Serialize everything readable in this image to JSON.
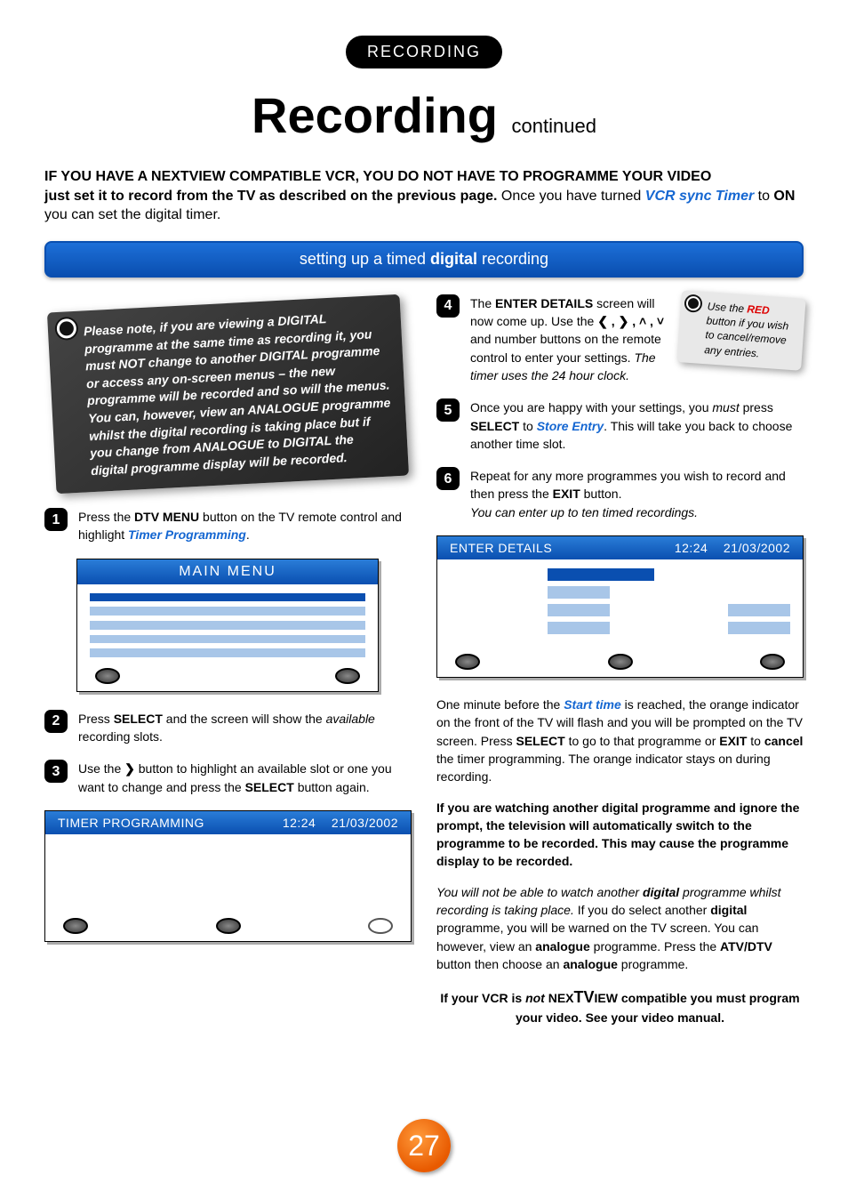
{
  "ribbon": "RECORDING",
  "title_main": "Recording",
  "title_cont": "continued",
  "intro_line1": "IF YOU HAVE A NEXTVIEW COMPATIBLE VCR, YOU DO NOT HAVE TO PROGRAMME YOUR VIDEO",
  "intro_line2_a": "just set it to record from the TV as described on the previous page.",
  "intro_line2_b": " Once you have turned ",
  "intro_line2_c": "VCR sync Timer",
  "intro_line2_d": " to ",
  "intro_line2_e": "ON",
  "intro_line2_f": " you can set the digital timer.",
  "section_header_a": "setting up a timed ",
  "section_header_b": "digital",
  "section_header_c": " recording",
  "note_card": "Please note, if you are viewing a DIGITAL programme at the same time as recording it, you must NOT change to another DIGITAL programme or access any on-screen menus – the new programme will be recorded and so will the menus. You can, however, view an ANALOGUE programme whilst the digital recording is taking place but if you change from ANALOGUE to DIGITAL the digital programme display will be recorded.",
  "tip_a": "Use the ",
  "tip_b": "RED",
  "tip_c": " button if you wish to cancel/remove any entries.",
  "steps": {
    "s1": {
      "num": "1",
      "a": "Press the ",
      "b": "DTV MENU",
      "c": " button on the TV remote control and highlight ",
      "d": "Timer Programming",
      "e": "."
    },
    "s2": {
      "num": "2",
      "a": "Press ",
      "b": "SELECT",
      "c": " and the screen will show the ",
      "d": "available",
      "e": " recording slots."
    },
    "s3": {
      "num": "3",
      "a": "Use the ",
      "arrow": "❯",
      "b": " button to highlight an available slot or one you want to change and press the ",
      "c": "SELECT",
      "d": " button again."
    },
    "s4": {
      "num": "4",
      "a": "The ",
      "b": "ENTER DETAILS",
      "c": " screen will now come up. Use the ",
      "arrows": "❮ , ❯ , ❮ , ❯",
      "d": " and number buttons on the remote control to enter your settings. ",
      "e": "The timer uses the 24 hour clock."
    },
    "s5": {
      "num": "5",
      "a": "Once you are happy with your settings, you ",
      "b": "must",
      "c": " press ",
      "d": "SELECT",
      "e": " to ",
      "f": "Store Entry",
      "g": ". This will take you back to choose another time slot."
    },
    "s6": {
      "num": "6",
      "a": "Repeat for any more programmes you wish to record and then press the ",
      "b": "EXIT",
      "c": " button.",
      "d": "You can enter up to ten timed recordings."
    }
  },
  "screens": {
    "main_menu": "MAIN MENU",
    "timer_prog": {
      "title": "TIMER PROGRAMMING",
      "time": "12:24",
      "date": "21/03/2002"
    },
    "enter_details": {
      "title": "ENTER DETAILS",
      "time": "12:24",
      "date": "21/03/2002"
    }
  },
  "extras": {
    "p1a": "One minute before the ",
    "p1b": "Start time",
    "p1c": " is reached, the orange indicator on the front of the TV will flash and you will be prompted on the TV screen. Press ",
    "p1d": "SELECT",
    "p1e": " to go to that programme or ",
    "p1f": "EXIT",
    "p1g": " to ",
    "p1h": "cancel",
    "p1i": " the timer programming. The orange indicator stays on during recording.",
    "p2": "If you are watching another digital programme and ignore the prompt, the television will automatically switch to the programme to be recorded. This may cause the programme display to be recorded.",
    "p3a": "You will not be able to watch another ",
    "p3b": "digital",
    "p3c": " programme whilst recording is taking place.",
    "p3d": " If you do select another ",
    "p3e": "digital",
    "p3f": " programme, you will be warned on the TV screen. You can however, view an ",
    "p3g": "analogue",
    "p3h": " programme. Press the ",
    "p3i": "ATV/DTV",
    "p3j": " button then choose an ",
    "p3k": "analogue",
    "p3l": " programme.",
    "p4a": "If your VCR is ",
    "p4b": "not",
    "p4c": " NEX",
    "p4d": "TV",
    "p4e": "IEW",
    "p4f": " compatible you must program your video. See your video manual."
  },
  "page_number": "27"
}
